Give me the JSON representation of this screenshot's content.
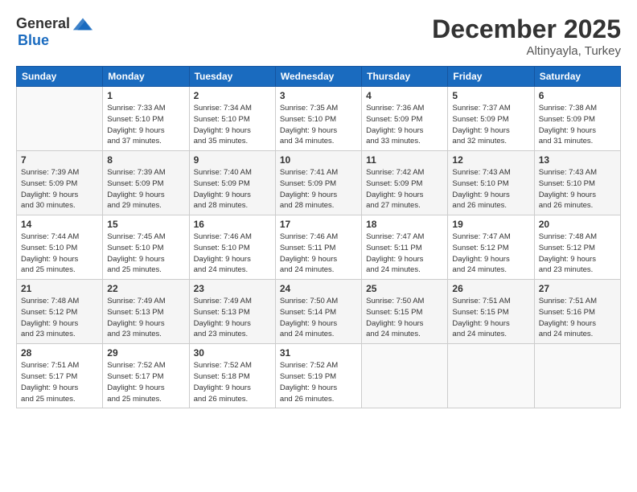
{
  "header": {
    "logo_general": "General",
    "logo_blue": "Blue",
    "title": "December 2025",
    "location": "Altinyayla, Turkey"
  },
  "calendar": {
    "days_of_week": [
      "Sunday",
      "Monday",
      "Tuesday",
      "Wednesday",
      "Thursday",
      "Friday",
      "Saturday"
    ],
    "weeks": [
      [
        {
          "day": "",
          "info": ""
        },
        {
          "day": "1",
          "info": "Sunrise: 7:33 AM\nSunset: 5:10 PM\nDaylight: 9 hours\nand 37 minutes."
        },
        {
          "day": "2",
          "info": "Sunrise: 7:34 AM\nSunset: 5:10 PM\nDaylight: 9 hours\nand 35 minutes."
        },
        {
          "day": "3",
          "info": "Sunrise: 7:35 AM\nSunset: 5:10 PM\nDaylight: 9 hours\nand 34 minutes."
        },
        {
          "day": "4",
          "info": "Sunrise: 7:36 AM\nSunset: 5:09 PM\nDaylight: 9 hours\nand 33 minutes."
        },
        {
          "day": "5",
          "info": "Sunrise: 7:37 AM\nSunset: 5:09 PM\nDaylight: 9 hours\nand 32 minutes."
        },
        {
          "day": "6",
          "info": "Sunrise: 7:38 AM\nSunset: 5:09 PM\nDaylight: 9 hours\nand 31 minutes."
        }
      ],
      [
        {
          "day": "7",
          "info": "Sunrise: 7:39 AM\nSunset: 5:09 PM\nDaylight: 9 hours\nand 30 minutes."
        },
        {
          "day": "8",
          "info": "Sunrise: 7:39 AM\nSunset: 5:09 PM\nDaylight: 9 hours\nand 29 minutes."
        },
        {
          "day": "9",
          "info": "Sunrise: 7:40 AM\nSunset: 5:09 PM\nDaylight: 9 hours\nand 28 minutes."
        },
        {
          "day": "10",
          "info": "Sunrise: 7:41 AM\nSunset: 5:09 PM\nDaylight: 9 hours\nand 28 minutes."
        },
        {
          "day": "11",
          "info": "Sunrise: 7:42 AM\nSunset: 5:09 PM\nDaylight: 9 hours\nand 27 minutes."
        },
        {
          "day": "12",
          "info": "Sunrise: 7:43 AM\nSunset: 5:10 PM\nDaylight: 9 hours\nand 26 minutes."
        },
        {
          "day": "13",
          "info": "Sunrise: 7:43 AM\nSunset: 5:10 PM\nDaylight: 9 hours\nand 26 minutes."
        }
      ],
      [
        {
          "day": "14",
          "info": "Sunrise: 7:44 AM\nSunset: 5:10 PM\nDaylight: 9 hours\nand 25 minutes."
        },
        {
          "day": "15",
          "info": "Sunrise: 7:45 AM\nSunset: 5:10 PM\nDaylight: 9 hours\nand 25 minutes."
        },
        {
          "day": "16",
          "info": "Sunrise: 7:46 AM\nSunset: 5:10 PM\nDaylight: 9 hours\nand 24 minutes."
        },
        {
          "day": "17",
          "info": "Sunrise: 7:46 AM\nSunset: 5:11 PM\nDaylight: 9 hours\nand 24 minutes."
        },
        {
          "day": "18",
          "info": "Sunrise: 7:47 AM\nSunset: 5:11 PM\nDaylight: 9 hours\nand 24 minutes."
        },
        {
          "day": "19",
          "info": "Sunrise: 7:47 AM\nSunset: 5:12 PM\nDaylight: 9 hours\nand 24 minutes."
        },
        {
          "day": "20",
          "info": "Sunrise: 7:48 AM\nSunset: 5:12 PM\nDaylight: 9 hours\nand 23 minutes."
        }
      ],
      [
        {
          "day": "21",
          "info": "Sunrise: 7:48 AM\nSunset: 5:12 PM\nDaylight: 9 hours\nand 23 minutes."
        },
        {
          "day": "22",
          "info": "Sunrise: 7:49 AM\nSunset: 5:13 PM\nDaylight: 9 hours\nand 23 minutes."
        },
        {
          "day": "23",
          "info": "Sunrise: 7:49 AM\nSunset: 5:13 PM\nDaylight: 9 hours\nand 23 minutes."
        },
        {
          "day": "24",
          "info": "Sunrise: 7:50 AM\nSunset: 5:14 PM\nDaylight: 9 hours\nand 24 minutes."
        },
        {
          "day": "25",
          "info": "Sunrise: 7:50 AM\nSunset: 5:15 PM\nDaylight: 9 hours\nand 24 minutes."
        },
        {
          "day": "26",
          "info": "Sunrise: 7:51 AM\nSunset: 5:15 PM\nDaylight: 9 hours\nand 24 minutes."
        },
        {
          "day": "27",
          "info": "Sunrise: 7:51 AM\nSunset: 5:16 PM\nDaylight: 9 hours\nand 24 minutes."
        }
      ],
      [
        {
          "day": "28",
          "info": "Sunrise: 7:51 AM\nSunset: 5:17 PM\nDaylight: 9 hours\nand 25 minutes."
        },
        {
          "day": "29",
          "info": "Sunrise: 7:52 AM\nSunset: 5:17 PM\nDaylight: 9 hours\nand 25 minutes."
        },
        {
          "day": "30",
          "info": "Sunrise: 7:52 AM\nSunset: 5:18 PM\nDaylight: 9 hours\nand 26 minutes."
        },
        {
          "day": "31",
          "info": "Sunrise: 7:52 AM\nSunset: 5:19 PM\nDaylight: 9 hours\nand 26 minutes."
        },
        {
          "day": "",
          "info": ""
        },
        {
          "day": "",
          "info": ""
        },
        {
          "day": "",
          "info": ""
        }
      ]
    ]
  }
}
